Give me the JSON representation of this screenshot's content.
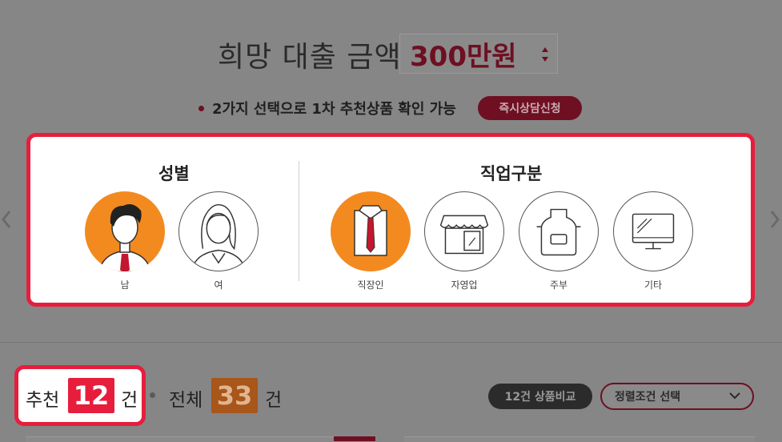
{
  "header": {
    "amount_title": "희망 대출 금액",
    "amount_value": "300만원",
    "guide_text": "2가지 선택으로 1차 추천상품 확인 가능",
    "consult_button": "즉시상담신청"
  },
  "gender": {
    "title": "성별",
    "options": [
      {
        "label": "남",
        "selected": true,
        "icon": "man-icon"
      },
      {
        "label": "여",
        "selected": false,
        "icon": "woman-icon"
      }
    ]
  },
  "job": {
    "title": "직업구분",
    "options": [
      {
        "label": "직장인",
        "selected": true,
        "icon": "shirt-tie-icon"
      },
      {
        "label": "자영업",
        "selected": false,
        "icon": "store-icon"
      },
      {
        "label": "주부",
        "selected": false,
        "icon": "apron-icon"
      },
      {
        "label": "기타",
        "selected": false,
        "icon": "monitor-icon"
      }
    ]
  },
  "results": {
    "recommended_label": "추천",
    "recommended_count": "12",
    "unit": "건",
    "total_label": "전체",
    "total_count": "33",
    "compare_button": "12건 상품비교",
    "sort_placeholder": "정렬조건 선택"
  },
  "colors": {
    "accent": "#e61e3c",
    "selected_fill": "#f38a1f",
    "amount_text": "#6e0f22",
    "total_badge": "#a8561a"
  }
}
